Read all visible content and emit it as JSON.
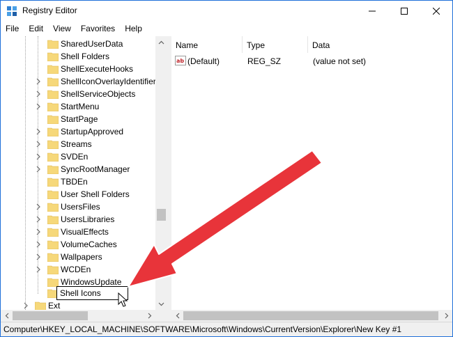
{
  "window": {
    "title": "Registry Editor"
  },
  "menu": [
    "File",
    "Edit",
    "View",
    "Favorites",
    "Help"
  ],
  "tree": {
    "items": [
      {
        "label": "SharedUserData",
        "expandable": false
      },
      {
        "label": "Shell Folders",
        "expandable": false
      },
      {
        "label": "ShellExecuteHooks",
        "expandable": false
      },
      {
        "label": "ShellIconOverlayIdentifier",
        "expandable": true
      },
      {
        "label": "ShellServiceObjects",
        "expandable": true
      },
      {
        "label": "StartMenu",
        "expandable": true
      },
      {
        "label": "StartPage",
        "expandable": false
      },
      {
        "label": "StartupApproved",
        "expandable": true
      },
      {
        "label": "Streams",
        "expandable": true
      },
      {
        "label": "SVDEn",
        "expandable": true
      },
      {
        "label": "SyncRootManager",
        "expandable": true
      },
      {
        "label": "TBDEn",
        "expandable": false
      },
      {
        "label": "User Shell Folders",
        "expandable": false
      },
      {
        "label": "UsersFiles",
        "expandable": true
      },
      {
        "label": "UsersLibraries",
        "expandable": true
      },
      {
        "label": "VisualEffects",
        "expandable": true
      },
      {
        "label": "VolumeCaches",
        "expandable": true
      },
      {
        "label": "Wallpapers",
        "expandable": true
      },
      {
        "label": "WCDEn",
        "expandable": true
      },
      {
        "label": "WindowsUpdate",
        "expandable": false
      }
    ],
    "editing_value": "Shell Icons",
    "next_parent_label": "Ext"
  },
  "list": {
    "headers": {
      "name": "Name",
      "type": "Type",
      "data": "Data"
    },
    "rows": [
      {
        "name": "(Default)",
        "type": "REG_SZ",
        "data": "(value not set)",
        "icon": "string-value-icon"
      }
    ]
  },
  "status": {
    "path": "Computer\\HKEY_LOCAL_MACHINE\\SOFTWARE\\Microsoft\\Windows\\CurrentVersion\\Explorer\\New Key #1"
  },
  "colors": {
    "annotation_arrow": "#e8343a",
    "folder": "#f6d87a",
    "window_border": "#1e6fd9"
  }
}
